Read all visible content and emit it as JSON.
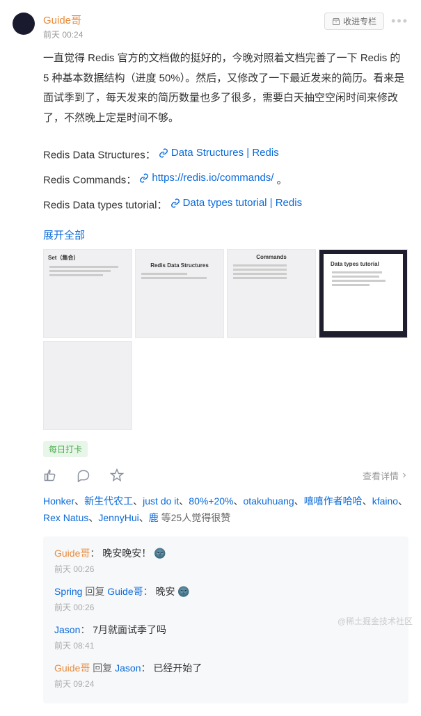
{
  "post": {
    "author": "Guide哥",
    "timestamp": "前天 00:24",
    "collect_label": "收进专栏",
    "body": "一直觉得 Redis 官方的文档做的挺好的，今晚对照着文档完善了一下 Redis 的 5 种基本数据结构（进度 50%）。然后，又修改了一下最近发来的简历。看来是面试季到了，每天发来的简历数量也多了很多，需要白天抽空空闲时间来修改了，不然晚上定是时间不够。",
    "links": [
      {
        "label": "Redis Data Structures：",
        "text": "Data Structures | Redis"
      },
      {
        "label": "Redis Commands：",
        "text": "https://redis.io/commands/",
        "suffix": " 。"
      },
      {
        "label": "Redis Data types tutorial：",
        "text": "Data types tutorial | Redis"
      }
    ],
    "expand": "展开全部",
    "thumbs": [
      {
        "title": "Set（集合）"
      },
      {
        "title": "Redis Data Structures"
      },
      {
        "title": "Commands"
      },
      {
        "title": "Data types tutorial",
        "dark": true
      },
      {
        "title": ""
      }
    ],
    "tag": "每日打卡",
    "view_detail": "查看详情",
    "likers": [
      "Honker",
      "新生代农工",
      "just do it",
      "80%+20%",
      "otakuhuang",
      "嘻嘻作者哈哈",
      "kfaino",
      "Rex Natus",
      "JennyHui",
      "鹿"
    ],
    "likers_suffix": " 等25人觉得很赞"
  },
  "comments": [
    {
      "user": "Guide哥",
      "user_color": "orange",
      "text": "晚安晚安！",
      "emoji": "🌚",
      "time": "前天 00:26"
    },
    {
      "user": "Spring",
      "user_color": "blue",
      "reply_label": "回复",
      "reply_to": "Guide哥",
      "text": "晚安",
      "emoji": "🌚",
      "time": "前天 00:26"
    },
    {
      "user": "Jason",
      "user_color": "blue",
      "text": "7月就面试季了吗",
      "time": "前天 08:41"
    },
    {
      "user": "Guide哥",
      "user_color": "orange",
      "reply_label": "回复",
      "reply_to": "Jason",
      "text": "已经开始了",
      "time": "前天 09:24"
    }
  ],
  "watermark": "@稀土掘金技术社区",
  "icons": {
    "link": "link-icon",
    "like": "thumb-up-icon",
    "comment": "comment-icon",
    "star": "star-icon",
    "box": "box-icon"
  }
}
